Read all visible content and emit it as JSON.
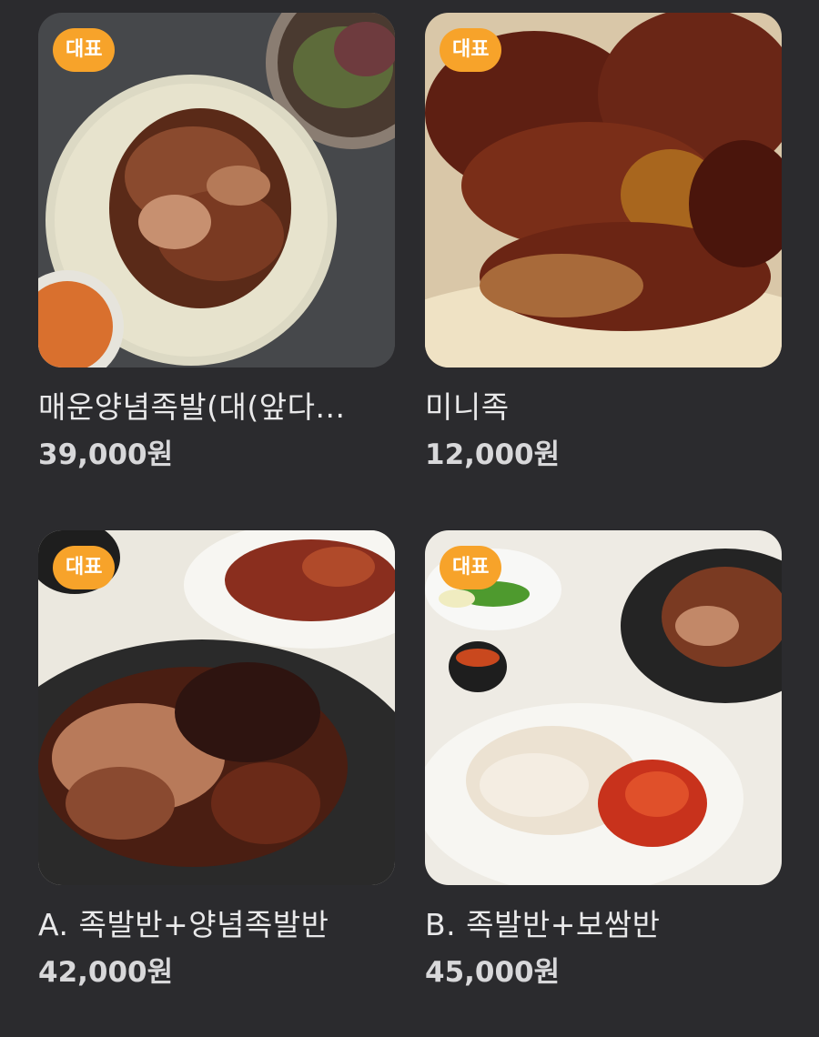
{
  "products": [
    {
      "badge": "대표",
      "name": "매운양념족발(대(앞다...",
      "price": "39,000원",
      "image": "spicy-jokbal-platter"
    },
    {
      "badge": "대표",
      "name": "미니족",
      "price": "12,000원",
      "image": "mini-jok-closeup"
    },
    {
      "badge": "대표",
      "name": "A. 족발반+양념족발반",
      "price": "42,000원",
      "image": "jokbal-half-spicy-half"
    },
    {
      "badge": "대표",
      "name": "B. 족발반+보쌈반",
      "price": "45,000원",
      "image": "jokbal-half-bossam-half"
    }
  ],
  "colors": {
    "background": "#2b2b2e",
    "badge": "#f7a32a",
    "text": "#e9e9ea"
  }
}
